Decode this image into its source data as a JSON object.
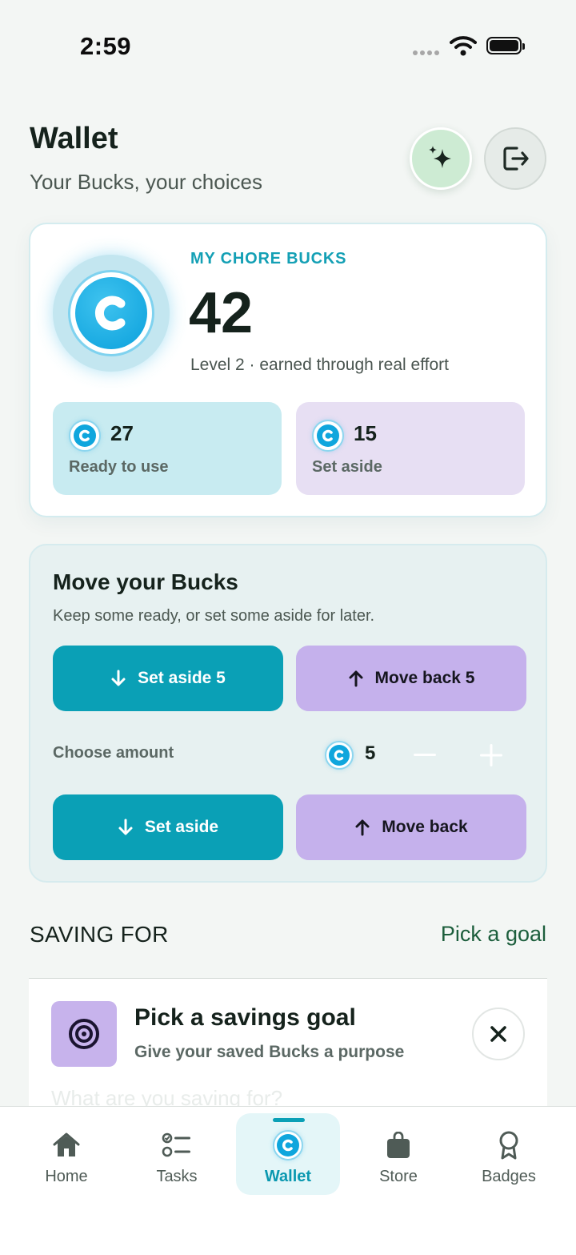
{
  "status_bar": {
    "time": "2:59"
  },
  "header": {
    "title": "Wallet",
    "subtitle": "Your Bucks, your choices",
    "sparkle_icon": "sparkles-icon",
    "logout_icon": "logout-icon"
  },
  "balance": {
    "label": "MY CHORE BUCKS",
    "amount": "42",
    "caption": "Level 2 · earned through real effort",
    "ready": {
      "amount": "27",
      "label": "Ready to use"
    },
    "aside": {
      "amount": "15",
      "label": "Set aside"
    }
  },
  "move": {
    "title": "Move your Bucks",
    "subtitle": "Keep some ready, or set some aside for later.",
    "quick_set_aside": "Set aside 5",
    "quick_move_back": "Move back 5",
    "choose_label": "Choose amount",
    "amount": "5",
    "set_aside": "Set aside",
    "move_back": "Move back"
  },
  "saving": {
    "heading": "SAVING FOR",
    "link": "Pick a goal",
    "goal_title": "Pick a savings goal",
    "goal_subtitle": "Give your saved Bucks a purpose",
    "goal_prompt": "What are you saving for?"
  },
  "tabs": [
    {
      "label": "Home",
      "icon": "home-icon"
    },
    {
      "label": "Tasks",
      "icon": "tasks-icon"
    },
    {
      "label": "Wallet",
      "icon": "coin-icon",
      "active": true
    },
    {
      "label": "Store",
      "icon": "bag-icon"
    },
    {
      "label": "Badges",
      "icon": "badge-icon"
    }
  ],
  "colors": {
    "accent_teal": "#0aa0b6",
    "lavender": "#c5b1ec",
    "mint": "#cdebd3",
    "coin_blue": "#0fa6dd"
  }
}
